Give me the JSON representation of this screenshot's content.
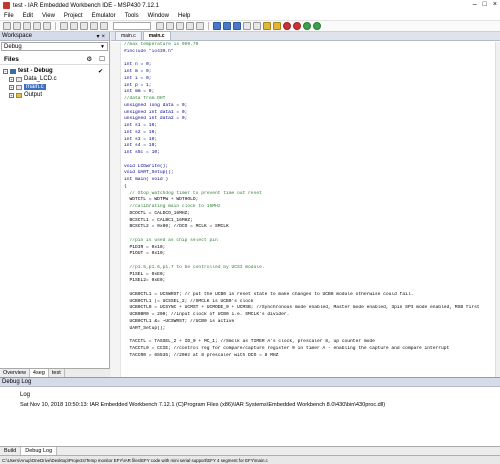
{
  "window": {
    "title": "test - IAR Embedded Workbench IDE - MSP430 7.12.1"
  },
  "menubar": [
    "File",
    "Edit",
    "View",
    "Project",
    "Emulator",
    "Tools",
    "Window",
    "Help"
  ],
  "workspace": {
    "title": "Workspace",
    "config": "Debug",
    "files_label": "Files",
    "tree": [
      {
        "label": "test - Debug",
        "bold": true,
        "check": "✔"
      },
      {
        "label": "Data_LCD.c",
        "bold": false,
        "check": ""
      },
      {
        "label": "main.c",
        "bold": false,
        "check": ""
      },
      {
        "label": "Output",
        "bold": false,
        "check": ""
      }
    ],
    "tabs": [
      "Overview",
      "4seg",
      "test"
    ]
  },
  "editor": {
    "tabs": [
      "main.c",
      "main.c"
    ],
    "code": [
      "//max temperature is 999.79",
      "#include \"io430.h\"",
      "",
      "int n = 0;",
      "int m = 0;",
      "int i = 0;",
      "int p = 1;",
      "int mm = 0;",
      "//data from DHT",
      "unsigned long data = 0;",
      "unsigned int data1 = 0;",
      "unsigned int data2 = 0;",
      "int s1 = 10;",
      "int s2 = 10;",
      "int s3 = 10;",
      "int s4 = 10;",
      "int s5c = 10;",
      "",
      "void LCDwrite();",
      "void UART_Setup();",
      "int main( void )",
      "{",
      "  // Stop watchdog timer to prevent time out reset",
      "  WDTCTL = WDTPW + WDTHOLD;",
      "  //calibrating main clock to 16MHz",
      "  DCOCTL = CALDCO_16MHZ;",
      "  BCSCTL1 = CALBC1_16MHZ;",
      "  BCSCTL2 = 0x00; //DCO = MCLK = SMCLK",
      "",
      "  //pin is used as chip select pin",
      "  P1DIR = 0x10;",
      "  P1OUT = 0x10;",
      "",
      "  //p1.5,p1.6,p1.7 to be controlled by UCSI module.",
      "  P1SEL = 0xE0;",
      "  P1SEL2= 0xE0;",
      "",
      "  UCB0CTL1 = UCSWRST; // put the UCB0 in reset state to make changes to UCB0 module otherwise could fail.",
      "  UCB0CTL1 |= UCSSEL_2; //SMCLK is UCB0's clock",
      "  UCB0CTL0 = UCSYNC + UCMST + UCMODE_0 + UCMSB; //Synchronous mode enabled, Master mode enabled, 3pin SPI mode enabled, MSB first",
      "  UCB0BR0 = 200; //input clock of UCB0 i.e. SMCLK's divider.",
      "  UCB0CTL1 &= ~UCSWRST; //UCB0 is active",
      "  UART_Setup();",
      "",
      "  TACCTL = TASSEL_2 + ID_0 + MC_1; //Smclk as TIMER A's clock, prescaler 8, up counter mode",
      "  TACCTL0 = CCIE; //control reg for compare/capture register 0 in timer A - enabling the capture and compare interrupt",
      "  TACCR0 = 65535; //20Hz at 8 prescaler with DCO = 8 MHZ"
    ]
  },
  "debug_log": {
    "title": "Debug Log",
    "column": "Log",
    "line": "Sat Nov 10, 2018 10:50:13: IAR Embedded Workbench 7.12.1 (C)Program Files (x86)\\IAR Systems\\Embedded Workbench 8.0\\430\\bin\\430proc.dll)",
    "tabs": [
      "Build",
      "Debug Log"
    ]
  },
  "statusbar": {
    "text": "C:\\Users\\Anup\\OneDrive\\Desktop\\Projects\\Temp monitor EFY\\IAR files\\EFY code with mini serial support\\EFY 4 segment for EFY\\main.c"
  }
}
